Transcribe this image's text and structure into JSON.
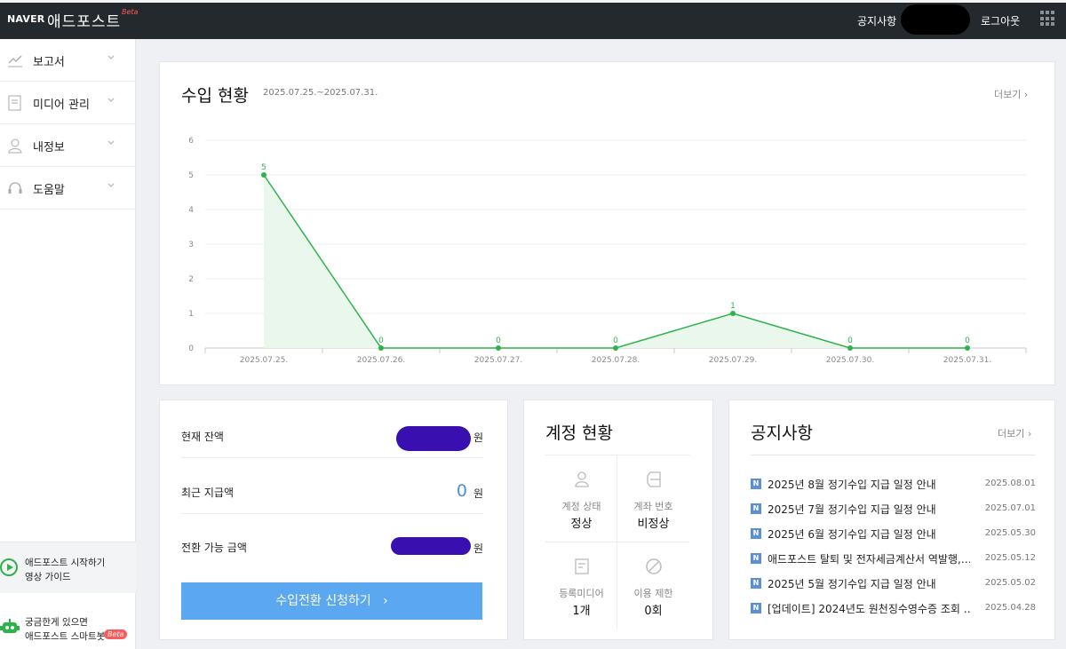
{
  "topbar": {
    "logo_naver": "NAVER",
    "logo_title": "애드포스트",
    "logo_beta": "Beta",
    "notice": "공지사항",
    "logout": "로그아웃",
    "user_icon": "redacted-user",
    "apps_icon": "apps-grid-icon"
  },
  "sidebar": {
    "items": [
      {
        "label": "보고서",
        "icon": "report-chart-icon"
      },
      {
        "label": "미디어 관리",
        "icon": "media-doc-icon"
      },
      {
        "label": "내정보",
        "icon": "person-icon"
      },
      {
        "label": "도움말",
        "icon": "headset-icon"
      }
    ],
    "guide_line1": "애드포스트 시작하기",
    "guide_line2": "영상 가이드",
    "bot_line1": "궁금한게 있으면",
    "bot_line2": "애드포스트 스마트봇",
    "bot_beta": "Beta"
  },
  "income": {
    "title": "수입 현황",
    "period": "2025.07.25.~2025.07.31.",
    "more": "더보기"
  },
  "chart_data": {
    "type": "area",
    "categories": [
      "2025.07.25.",
      "2025.07.26.",
      "2025.07.27.",
      "2025.07.28.",
      "2025.07.29.",
      "2025.07.30.",
      "2025.07.31."
    ],
    "values": [
      5,
      0,
      0,
      0,
      1,
      0,
      0
    ],
    "yticks": [
      0,
      1,
      2,
      3,
      4,
      5,
      6
    ],
    "ylim": [
      0,
      6
    ],
    "grid": true,
    "line_color": "#2db34a",
    "fill_color": "#eaf7ec",
    "data_labels": true
  },
  "balance": {
    "current_label": "현재 잔액",
    "current_unit": "원",
    "recent_label": "최근 지급액",
    "recent_value": "0",
    "recent_unit": "원",
    "convertible_label": "전환 가능 금액",
    "convertible_unit": "원",
    "button": "수입전환 신청하기"
  },
  "account": {
    "title": "계정 현황",
    "cells": [
      {
        "label": "계정 상태",
        "value": "정상",
        "icon": "person-outline-icon"
      },
      {
        "label": "계좌 번호",
        "value": "비정상",
        "icon": "bankbook-icon"
      },
      {
        "label": "등록미디어",
        "value": "1개",
        "icon": "document-icon"
      },
      {
        "label": "이용 제한",
        "value": "0회",
        "icon": "prohibited-icon"
      }
    ]
  },
  "notice": {
    "title": "공지사항",
    "more": "더보기",
    "badge": "N",
    "items": [
      {
        "text": "2025년 8월 정기수입 지급 일정 안내",
        "date": "2025.08.01"
      },
      {
        "text": "2025년 7월 정기수입 지급 일정 안내",
        "date": "2025.07.01"
      },
      {
        "text": "2025년 6월 정기수입 지급 일정 안내",
        "date": "2025.05.30"
      },
      {
        "text": "애드포스트 탈퇴 및 전자세금계산서 역발행,…",
        "date": "2025.05.12"
      },
      {
        "text": "2025년 5월 정기수입 지급 일정 안내",
        "date": "2025.05.02"
      },
      {
        "text": "[업데이트] 2024년도 원천징수영수증 조회 …",
        "date": "2025.04.28"
      }
    ]
  },
  "colors": {
    "topbar_bg": "#24292e",
    "accent_green": "#2db34a",
    "button_blue": "#5ba7f0",
    "redaction": "#3a0fb0"
  }
}
